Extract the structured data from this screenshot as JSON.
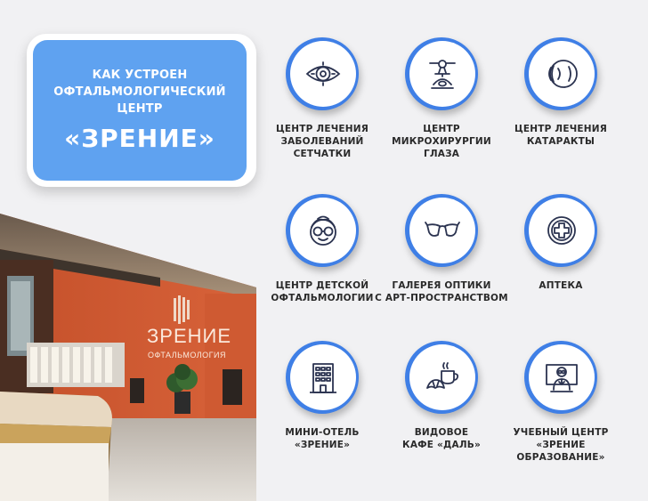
{
  "title": {
    "line1": "КАК УСТРОЕН",
    "line2": "ОФТАЛЬМОЛОГИЧЕСКИЙ",
    "line3": "ЦЕНТР",
    "name": "«ЗРЕНИЕ»"
  },
  "photo": {
    "sign_name": "ЗРЕНИЕ",
    "sign_sub": "ОФТАЛЬМОЛОГИЯ"
  },
  "items": [
    {
      "label": "ЦЕНТР ЛЕЧЕНИЯ\nЗАБОЛЕВАНИЙ\nСЕТЧАТКИ",
      "icon": "eye-icon"
    },
    {
      "label": "ЦЕНТР\nМИКРОХИРУРГИИ\nГЛАЗА",
      "icon": "microscope-icon"
    },
    {
      "label": "ЦЕНТР ЛЕЧЕНИЯ\nКАТАРАКТЫ",
      "icon": "eye-profile-icon"
    },
    {
      "label": "ЦЕНТР ДЕТСКОЙ\nОФТАЛЬМОЛОГИИ",
      "icon": "child-glasses-icon"
    },
    {
      "label": "ГАЛЕРЕЯ ОПТИКИ\nС АРТ-ПРОСТРАНСТВОМ",
      "icon": "eyeglasses-icon"
    },
    {
      "label": "АПТЕКА",
      "icon": "pharmacy-cross-icon"
    },
    {
      "label": "МИНИ-ОТЕЛЬ\n«ЗРЕНИЕ»",
      "icon": "hotel-building-icon"
    },
    {
      "label": "ВИДОВОЕ\nКАФЕ «ДАЛЬ»",
      "icon": "coffee-croissant-icon"
    },
    {
      "label": "УЧЕБНЫЙ ЦЕНТР\n«ЗРЕНИЕ ОБРАЗОВАНИЕ»",
      "icon": "teacher-board-icon"
    }
  ],
  "colors": {
    "accent": "#5fa2f0",
    "ring": "#3f7fe6",
    "icon_stroke": "#2b3350",
    "background": "#f1f1f3"
  }
}
